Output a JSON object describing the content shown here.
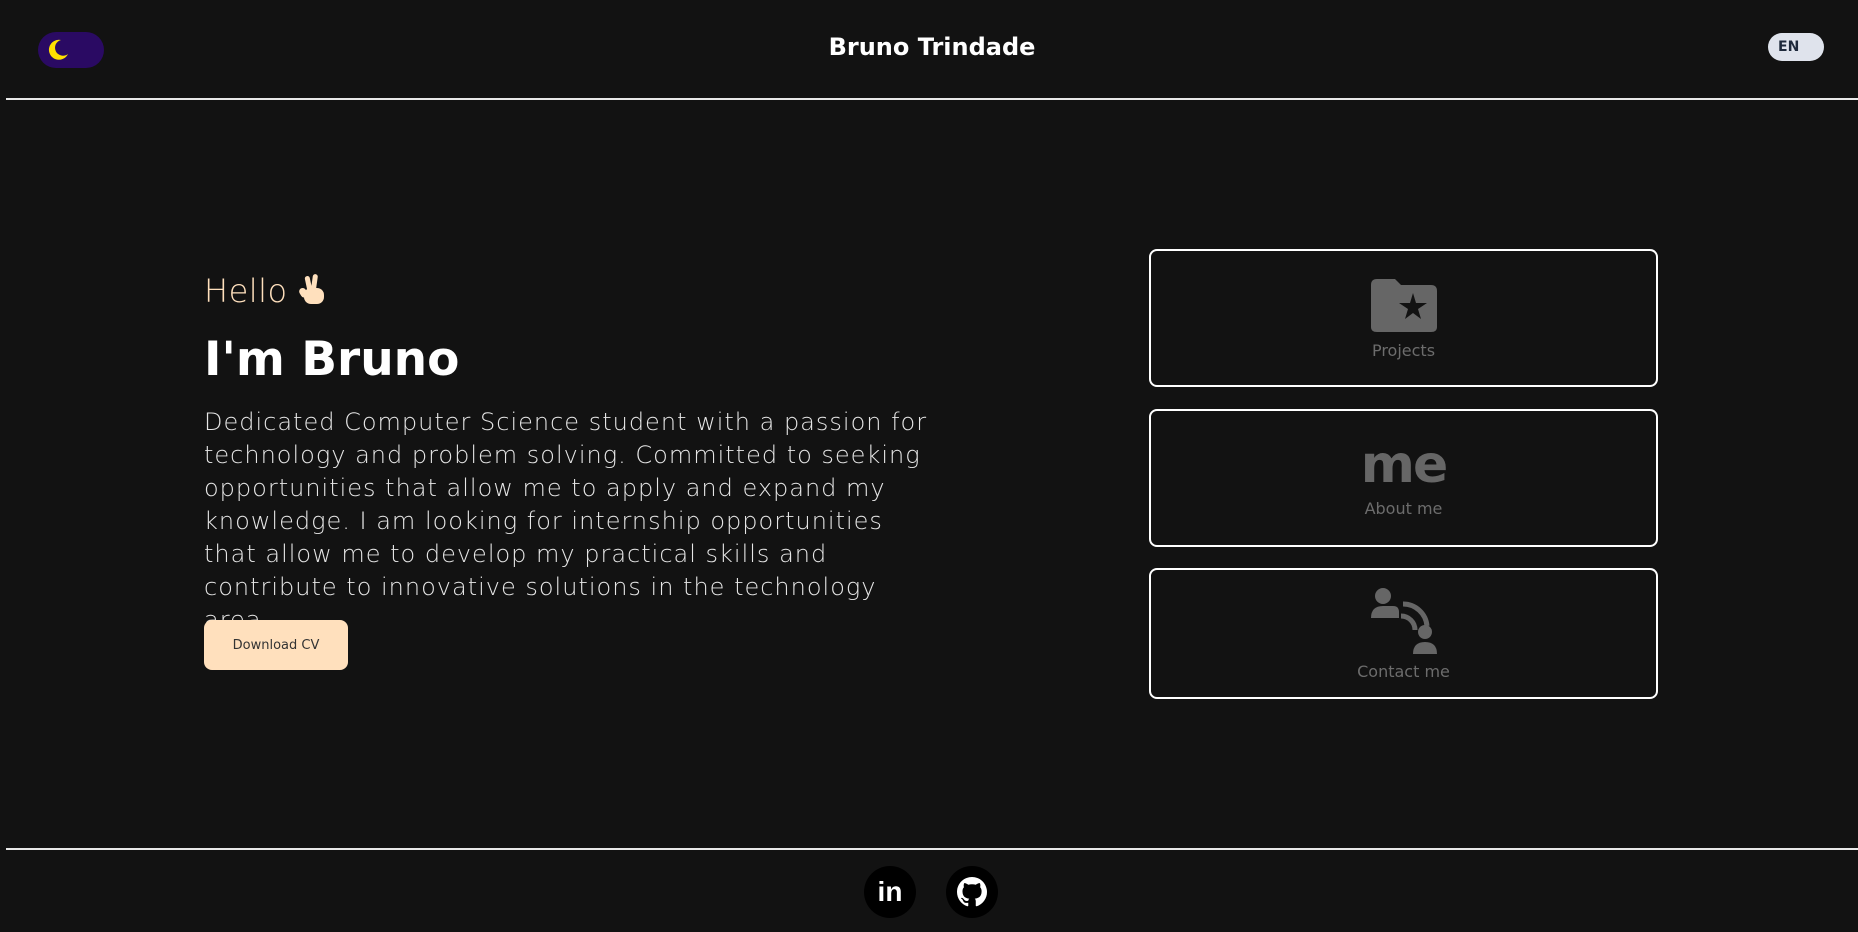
{
  "header": {
    "title": "Bruno Trindade",
    "language": "EN",
    "theme_icon": "moon-icon"
  },
  "hero": {
    "greeting": "Hello",
    "greeting_icon": "peace-hand-icon",
    "headline": "I'm Bruno",
    "bio": "Dedicated Computer Science student with a passion for technology and problem solving. Committed to seeking opportunities that allow me to apply and expand my knowledge. I am looking for internship opportunities that allow me to develop my practical skills and contribute to innovative solutions in the technology area.",
    "download_label": "Download CV"
  },
  "cards": [
    {
      "label": "Projects",
      "icon": "folder-star-icon"
    },
    {
      "label": "About me",
      "icon_text": "me"
    },
    {
      "label": "Contact me",
      "icon": "people-signal-icon"
    }
  ],
  "footer": {
    "linkedin_icon_text": "in",
    "social_icons": [
      "linkedin-icon",
      "github-icon"
    ]
  },
  "colors": {
    "background": "#121212",
    "accent": "#ffe0bd",
    "toggle": "#2a0a63",
    "moon": "#ffe000",
    "card_icon": "#666666"
  }
}
